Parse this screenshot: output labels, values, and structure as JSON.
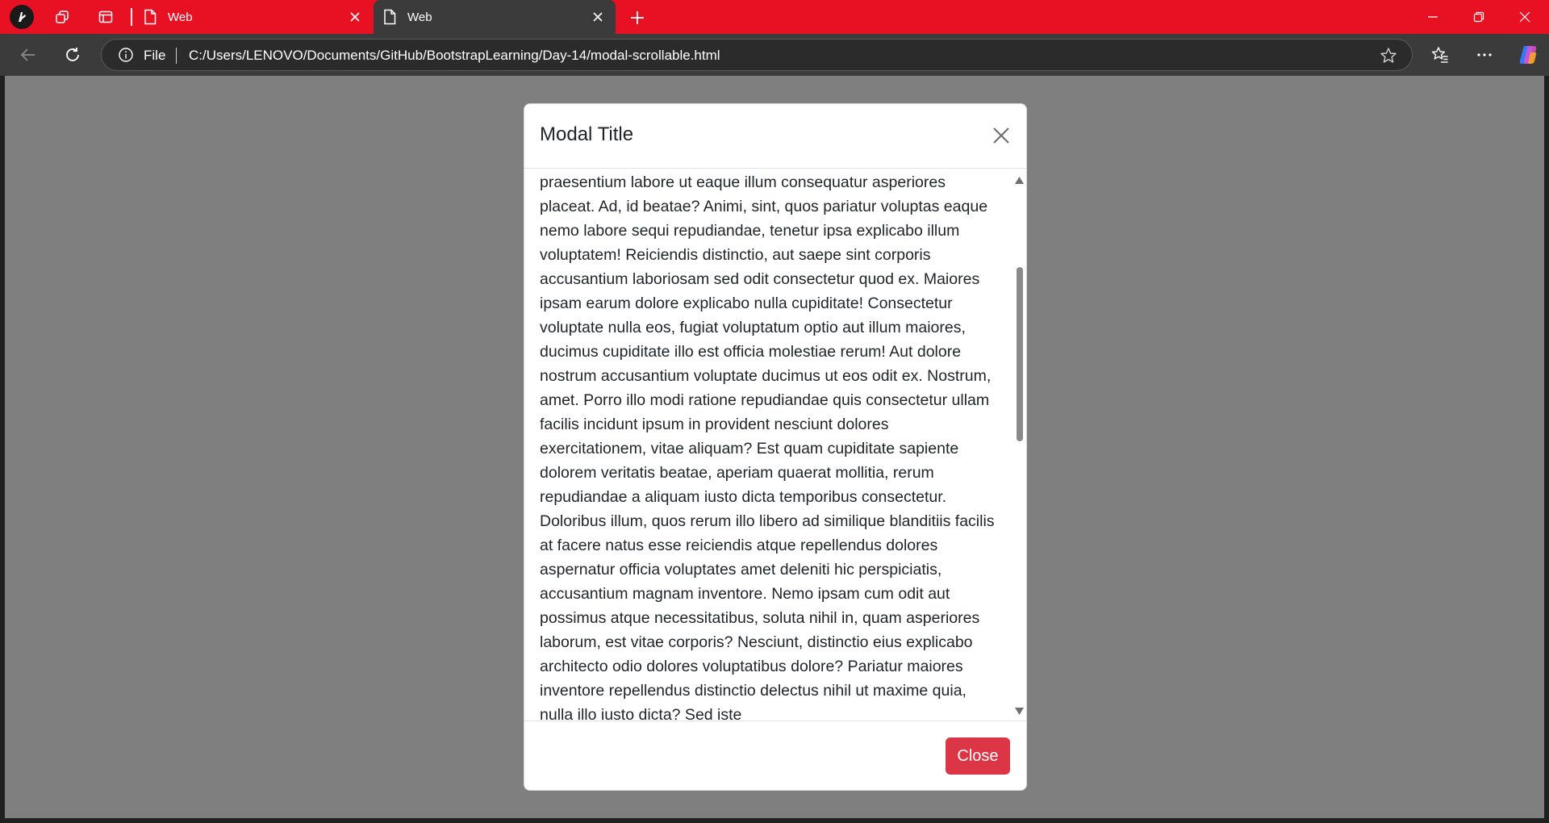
{
  "browser": {
    "tabs": [
      {
        "title": "Web",
        "active": false
      },
      {
        "title": "Web",
        "active": true
      }
    ],
    "address_bar": {
      "scheme_label": "File",
      "url": "C:/Users/LENOVO/Documents/GitHub/BootstrapLearning/Day-14/modal-scrollable.html"
    },
    "colors": {
      "tabstrip": "#e81123",
      "toolbar": "#3b3b3b",
      "backdrop": "#7f7f7f"
    },
    "icons": [
      "profile-icon",
      "workspaces-icon",
      "tab-actions-icon",
      "page-icon",
      "close-icon",
      "new-tab-icon",
      "minimize-icon",
      "restore-icon",
      "back-icon",
      "refresh-icon",
      "info-icon",
      "star-icon",
      "favorites-icon",
      "more-icon",
      "copilot-icon"
    ]
  },
  "modal": {
    "title": "Modal Title",
    "body_text": "praesentium labore ut eaque illum consequatur asperiores placeat. Ad, id beatae? Animi, sint, quos pariatur voluptas eaque nemo labore sequi repudiandae, tenetur ipsa explicabo illum voluptatem! Reiciendis distinctio, aut saepe sint corporis accusantium laboriosam sed odit consectetur quod ex. Maiores ipsam earum dolore explicabo nulla cupiditate! Consectetur voluptate nulla eos, fugiat voluptatum optio aut illum maiores, ducimus cupiditate illo est officia molestiae rerum! Aut dolore nostrum accusantium voluptate ducimus ut eos odit ex. Nostrum, amet. Porro illo modi ratione repudiandae quis consectetur ullam facilis incidunt ipsum in provident nesciunt dolores exercitationem, vitae aliquam? Est quam cupiditate sapiente dolorem veritatis beatae, aperiam quaerat mollitia, rerum repudiandae a aliquam iusto dicta temporibus consectetur. Doloribus illum, quos rerum illo libero ad similique blanditiis facilis at facere natus esse reiciendis atque repellendus dolores aspernatur officia voluptates amet deleniti hic perspiciatis, accusantium magnam inventore. Nemo ipsam cum odit aut possimus atque necessitatibus, soluta nihil in, quam asperiores laborum, est vitae corporis? Nesciunt, distinctio eius explicabo architecto odio dolores voluptatibus dolore? Pariatur maiores inventore repellendus distinctio delectus nihil ut maxime quia, nulla illo iusto dicta? Sed iste",
    "close_button": "Close",
    "colors": {
      "close_button": "#dc3545"
    }
  }
}
